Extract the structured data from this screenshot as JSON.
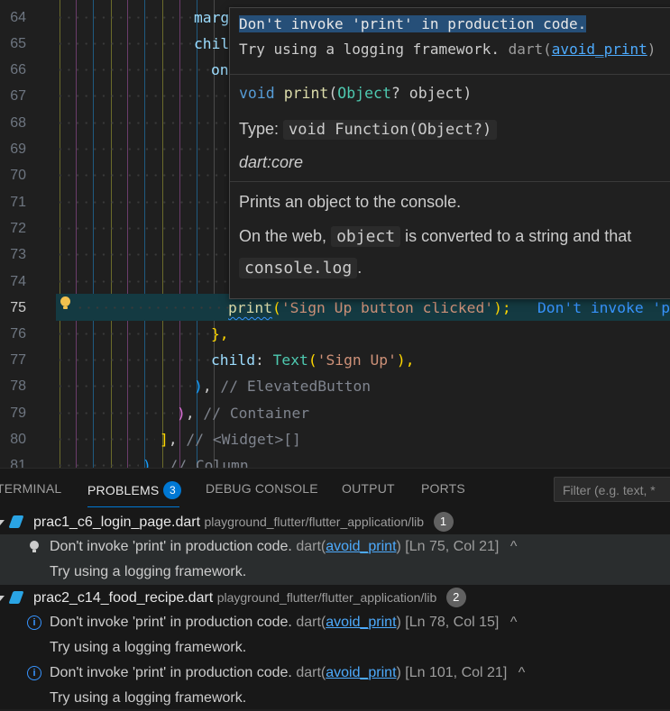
{
  "editor": {
    "line_numbers": [
      "64",
      "65",
      "66",
      "67",
      "68",
      "69",
      "70",
      "71",
      "72",
      "73",
      "74",
      "75",
      "76",
      "77",
      "78",
      "79",
      "80",
      "81"
    ],
    "active_line": "75",
    "code": {
      "l64": "marg",
      "l65": "chil",
      "l66": "on",
      "l75_fn": "print",
      "l75_open": "(",
      "l75_str": "'Sign Up button clicked'",
      "l75_close": ");",
      "l75_ghost": "Don't invoke 'pr",
      "l76": "},",
      "l77_prop": "child",
      "l77_colon": ": ",
      "l77_type": "Text",
      "l77_open": "(",
      "l77_str": "'Sign Up'",
      "l77_close": "),",
      "l78_paren": ")",
      "l78_comma": ", ",
      "l78_cmt": "// ElevatedButton",
      "l79_paren": ")",
      "l79_comma": ", ",
      "l79_cmt": "// Container",
      "l80_br": "]",
      "l80_comma": ", ",
      "l80_cmt": "// <Widget>[]",
      "l81_paren": ")",
      "l81_comma": ", ",
      "l81_cmt": "// Column"
    }
  },
  "hover": {
    "message_title": "Don't invoke 'print' in production code.",
    "message_hint": "Try using a logging framework.",
    "source": "dart(",
    "rule_link": "avoid_print",
    "source_close": ")",
    "signature_kw": "void",
    "signature_fn": "print",
    "signature_open": "(",
    "signature_type": "Object",
    "signature_rest": "? object)",
    "type_label": "Type:",
    "type_value": "void Function(Object?)",
    "library": "dart:core",
    "doc_line1": "Prints an object to the console.",
    "doc_line2_pre": "On the web,",
    "doc_code1": "object",
    "doc_line2_post": "is converted to a string and that",
    "doc_code2": "console.log",
    "doc_line3_post": "."
  },
  "panel": {
    "tabs": [
      "TERMINAL",
      "PROBLEMS",
      "DEBUG CONSOLE",
      "OUTPUT",
      "PORTS"
    ],
    "problems_count": "3",
    "filter_placeholder": "Filter (e.g. text, *",
    "groups": [
      {
        "file": "prac1_c6_login_page.dart",
        "path": "playground_flutter/flutter_application/lib",
        "count": "1",
        "items": [
          {
            "message": "Don't invoke 'print' in production code.",
            "source": "dart(",
            "rule": "avoid_print",
            "source_close": ")",
            "location": "[Ln 75, Col 21]",
            "hint": "Try using a logging framework."
          }
        ]
      },
      {
        "file": "prac2_c14_food_recipe.dart",
        "path": "playground_flutter/flutter_application/lib",
        "count": "2",
        "items": [
          {
            "message": "Don't invoke 'print' in production code.",
            "source": "dart(",
            "rule": "avoid_print",
            "source_close": ")",
            "location": "[Ln 78, Col 15]",
            "hint": "Try using a logging framework."
          },
          {
            "message": "Don't invoke 'print' in production code.",
            "source": "dart(",
            "rule": "avoid_print",
            "source_close": ")",
            "location": "[Ln 101, Col 21]",
            "hint": "Try using a logging framework."
          }
        ]
      }
    ],
    "info_glyph": "i",
    "collapse_glyph": "^"
  }
}
